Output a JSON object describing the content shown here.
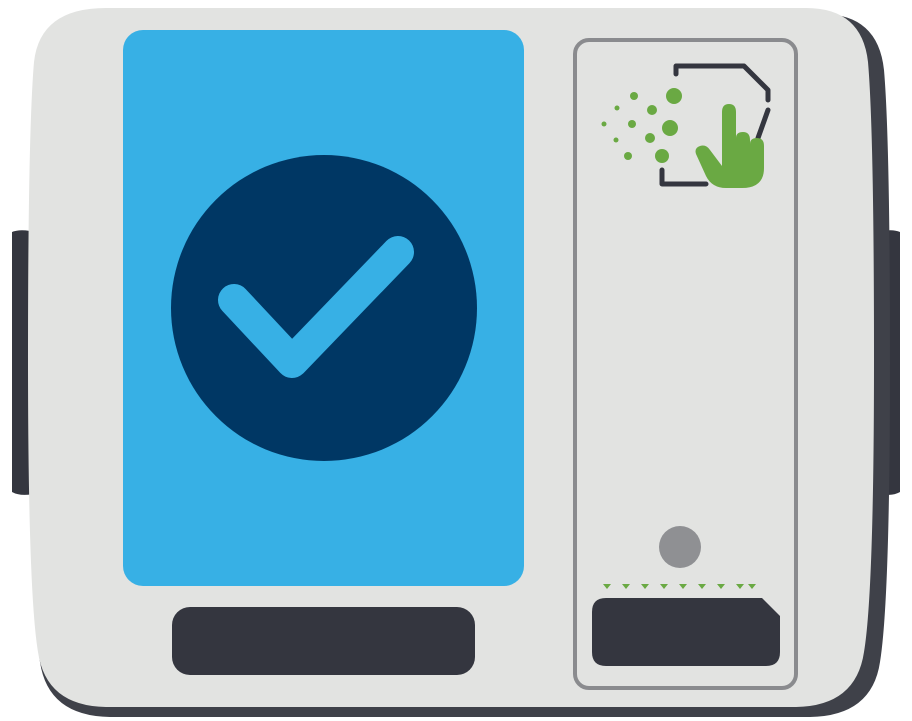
{
  "device": {
    "body_color": "#e2e3e1",
    "shadow_color": "#3f4149",
    "dark_color": "#34363f",
    "outline_color": "#8a8b8e",
    "screen_color": "#37b0e5",
    "check_circle_color": "#003764",
    "check_color": "#37b0e5",
    "indicator_light_color": "#8f9093",
    "accent_green": "#6aa943"
  },
  "icons": {
    "screen": "check-circle-icon",
    "reader": "contactless-tap-icon",
    "slot_guide": "arrow-down-triangles-icon"
  }
}
